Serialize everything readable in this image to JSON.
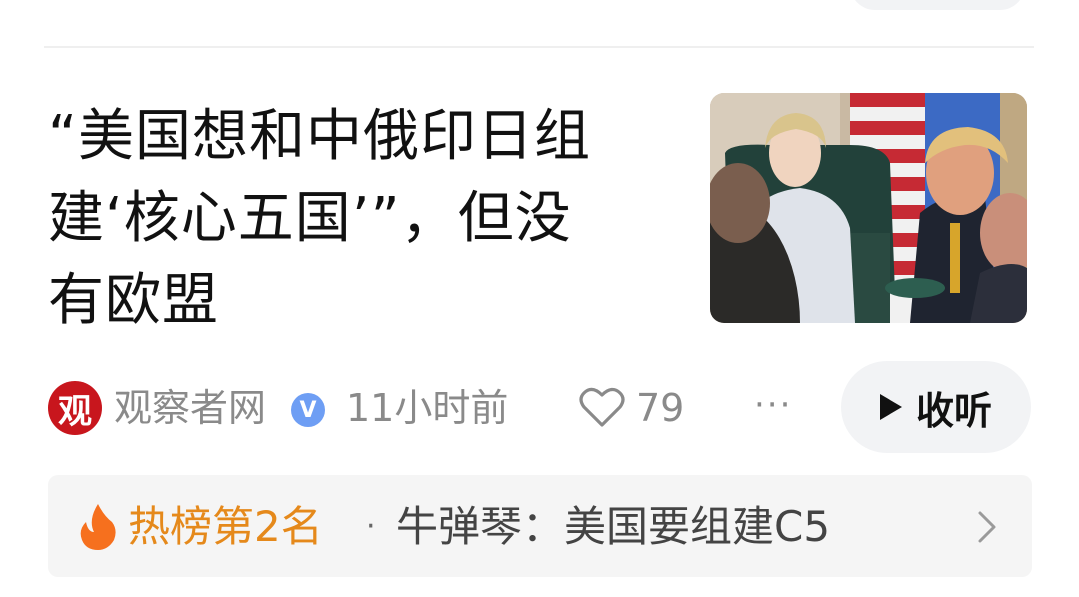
{
  "article": {
    "headline_line1": "“美国想和中俄印日组",
    "headline_line2": "建‘核心五国’”，但没",
    "headline_line3": "有欧盟",
    "thumbnail_icon": "news-photo"
  },
  "meta": {
    "source_logo_char": "观",
    "source_name": "观察者网",
    "verified_char": "V",
    "time": "11小时前",
    "like_count": "79",
    "more": "···"
  },
  "listen": {
    "label": "收听"
  },
  "hot": {
    "rank": "热榜第2名",
    "separator": "·",
    "text": "牛弹琴：美国要组建C5"
  },
  "colors": {
    "hot_orange": "#e5891b",
    "logo_red": "#c8161d",
    "verified_blue": "#6e9ef4",
    "muted_text": "#8a8a8a"
  }
}
